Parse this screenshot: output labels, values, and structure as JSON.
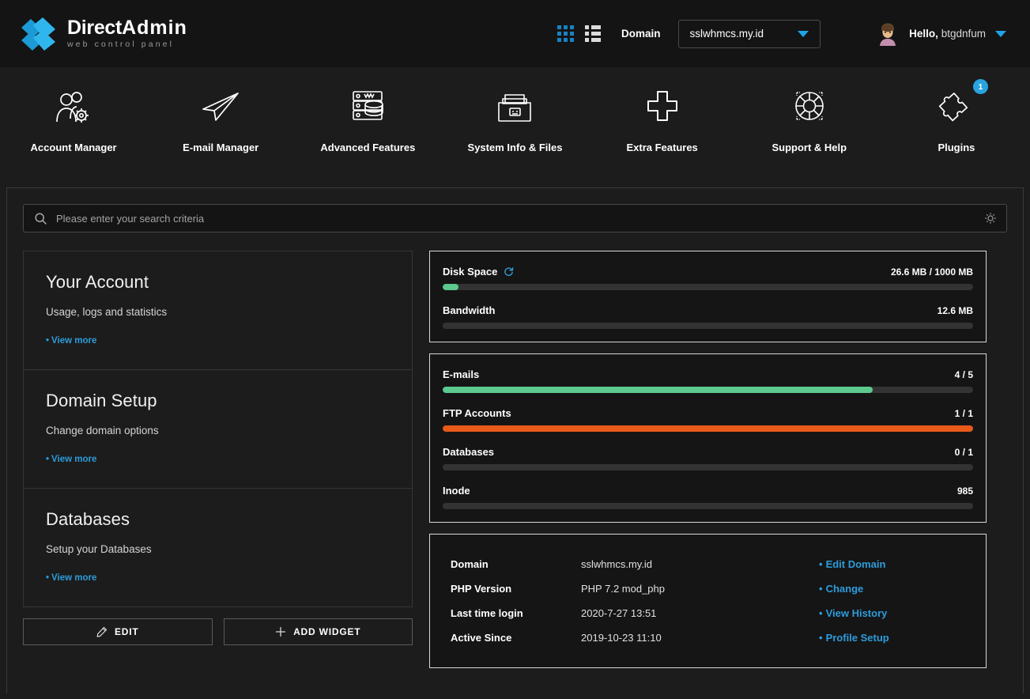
{
  "brand": {
    "title_part1": "Direct",
    "title_part2": "Admin",
    "subtitle": "web control panel",
    "logo_icon": "double-chevron-right-icon",
    "accent": "#1fa3e8"
  },
  "topbar": {
    "grid_view_icon": "grid-view-icon",
    "list_view_icon": "list-view-icon",
    "domain_label": "Domain",
    "domain_value": "sslwhmcs.my.id",
    "dropdown_icon": "chevron-down-icon",
    "avatar_icon": "user-avatar-icon",
    "greeting_bold": "Hello,",
    "greeting_user": "btgdnfum",
    "user_menu_icon": "chevron-down-icon"
  },
  "nav": {
    "items": [
      {
        "label": "Account Manager",
        "icon": "users-gear-icon"
      },
      {
        "label": "E-mail Manager",
        "icon": "paper-plane-icon"
      },
      {
        "label": "Advanced Features",
        "icon": "server-database-icon"
      },
      {
        "label": "System Info & Files",
        "icon": "folder-files-icon"
      },
      {
        "label": "Extra Features",
        "icon": "plus-icon"
      },
      {
        "label": "Support & Help",
        "icon": "life-ring-icon"
      },
      {
        "label": "Plugins",
        "icon": "puzzle-piece-icon",
        "badge": "1"
      }
    ]
  },
  "search": {
    "placeholder": "Please enter your search criteria",
    "value": "",
    "search_icon": "search-icon",
    "settings_icon": "gear-icon"
  },
  "widgets": {
    "cards": [
      {
        "title": "Your Account",
        "subtitle": "Usage, logs and statistics",
        "link": "View more"
      },
      {
        "title": "Domain Setup",
        "subtitle": "Change domain options",
        "link": "View more"
      },
      {
        "title": "Databases",
        "subtitle": "Setup your Databases",
        "link": "View more"
      }
    ],
    "edit_label": "EDIT",
    "edit_icon": "pencil-icon",
    "add_widget_label": "ADD WIDGET",
    "add_widget_icon": "plus-icon"
  },
  "usage": {
    "card1": [
      {
        "name": "Disk Space",
        "value": "26.6 MB / 1000 MB",
        "percent": 3,
        "color": "#5cc98f",
        "icon": "refresh-icon"
      },
      {
        "name": "Bandwidth",
        "value": "12.6 MB",
        "percent": 0,
        "color": "#5cc98f"
      }
    ],
    "card2": [
      {
        "name": "E-mails",
        "value": "4 / 5",
        "percent": 81,
        "color": "#5cc98f"
      },
      {
        "name": "FTP Accounts",
        "value": "1 / 1",
        "percent": 100,
        "color": "#e8591a"
      },
      {
        "name": "Databases",
        "value": "0 / 1",
        "percent": 0,
        "color": "#5cc98f"
      },
      {
        "name": "Inode",
        "value": "985",
        "percent": 0,
        "color": "#5cc98f"
      }
    ]
  },
  "info": {
    "rows": [
      {
        "key": "Domain",
        "value": "sslwhmcs.my.id",
        "action": "Edit Domain"
      },
      {
        "key": "PHP Version",
        "value": "PHP 7.2 mod_php",
        "action": "Change"
      },
      {
        "key": "Last time login",
        "value": "2020-7-27 13:51",
        "action": "View History"
      },
      {
        "key": "Active Since",
        "value": "2019-10-23 11:10",
        "action": "Profile Setup"
      }
    ]
  }
}
